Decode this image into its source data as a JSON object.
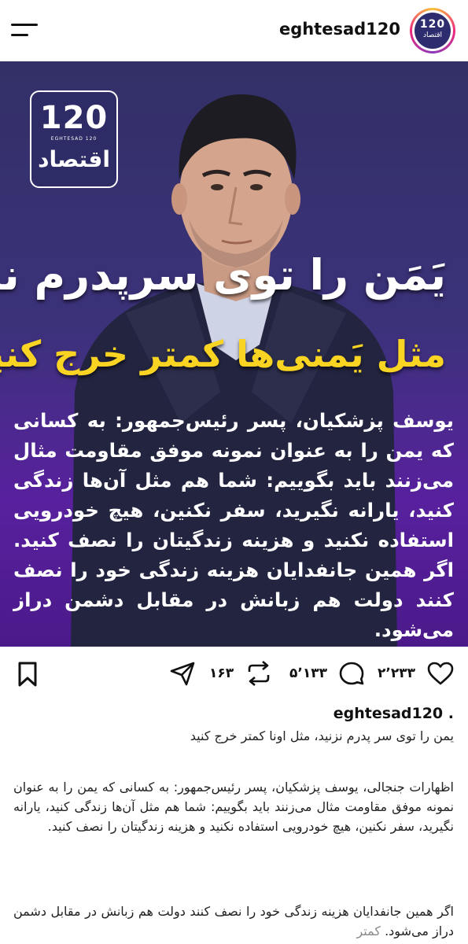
{
  "header": {
    "account_name": "eghtesad120",
    "avatar_number": "120",
    "avatar_word": "اقتصاد"
  },
  "post_image": {
    "logo_number": "120",
    "logo_english": "EGHTESAD 120",
    "logo_word": "اقتصاد",
    "headline_1": "یَمَن را توی سرپدرم نزنید",
    "headline_2": "مثل یَمنی‌ها کمتر خرج کنید",
    "body": "یوسف پزشکیان، پسر رئیس‌جمهور: به کسانی که یمن را به عنوان نمونه موفق مقاومت مثال می‌زنند باید بگوییم: شما هم مثل آن‌ها زندگی کنید، یارانه نگیرید، سفر نکنین، هیچ خودرویی استفاده نکنید و هزینه زندگیتان را نصف کنید. اگر همین جانفدایان هزینه زندگی خود را نصف کنند دولت هم زبانش در مقابل دشمن دراز می‌شود.",
    "colors": {
      "headline_2": "#f9d423",
      "background_bottom": "#58209e"
    }
  },
  "actions": {
    "likes": "۲٬۲۳۳",
    "comments": "۵٬۱۳۳",
    "reposts": "۱۶۳",
    "icons": [
      "heart-icon",
      "comment-icon",
      "repost-icon",
      "share-icon",
      "bookmark-icon"
    ]
  },
  "caption": {
    "username": "eghtesad120 .",
    "title": "یمن را توی سر پدرم نزنید، مثل اونا کمتر خرج کنید",
    "paragraph_1": "اظهارات جنجالی، یوسف پزشکیان، پسر رئیس‌جمهور: به کسانی که یمن را به عنوان نمونه موفق مقاومت مثال می‌زنند باید بگوییم: شما هم مثل آن‌ها زندگی کنید، یارانه نگیرید، سفر نکنین، هیچ خودرویی استفاده نکنید و هزینه زندگیتان را نصف کنید.",
    "paragraph_2": "اگر همین جانفدایان هزینه زندگی خود را نصف کنند دولت هم زبانش در مقابل دشمن دراز می‌شود.",
    "more_label": "کمتر"
  }
}
